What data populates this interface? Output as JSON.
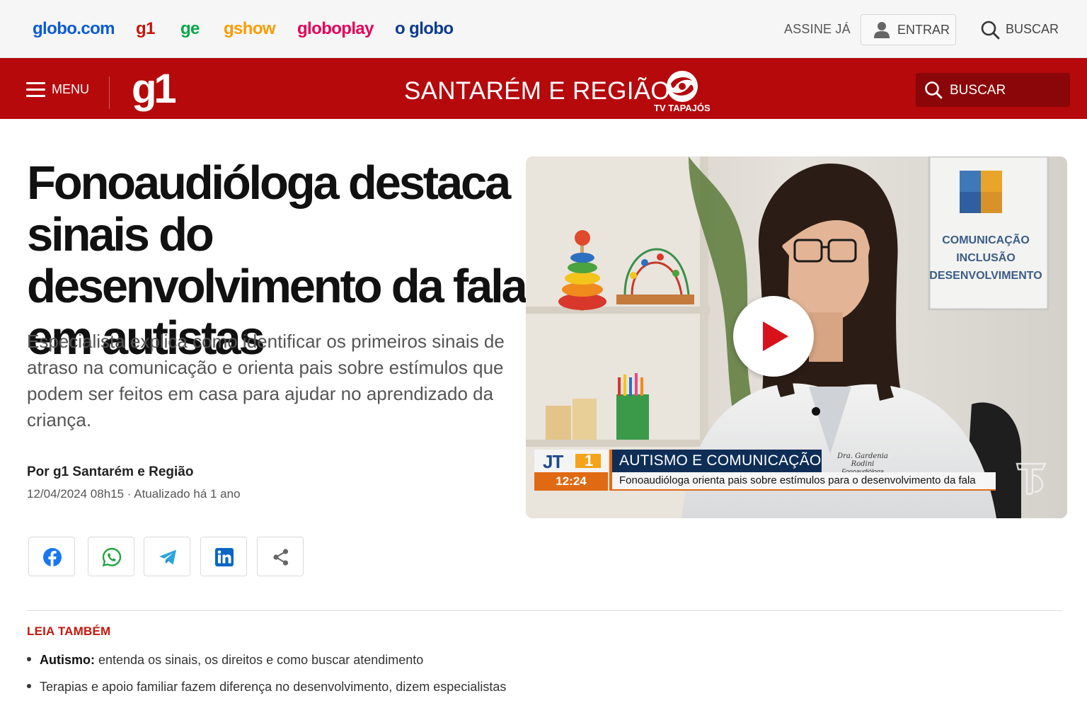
{
  "topbar": {
    "brands": {
      "globocom": "globo.com",
      "g1": "g1",
      "ge": "ge",
      "gshow": "gshow",
      "globoplay": "globoplay",
      "oglobo": "o globo"
    },
    "assine": "ASSINE JÁ",
    "entrar": "ENTRAR",
    "buscar": "BUSCAR"
  },
  "header": {
    "menu": "MENU",
    "logo": "g1",
    "region": "SANTARÉM E REGIÃO",
    "tv_label": "TV TAPAJÓS",
    "search": "BUSCAR"
  },
  "article": {
    "headline": "Fonoaudióloga destaca sinais do desenvolvimento da fala em autistas",
    "subtitle": "Especialista explica como identificar os primeiros sinais de atraso na comunicação e orienta pais sobre estímulos que podem ser feitos em casa para ajudar no aprendizado da criança.",
    "byline": "Por g1 Santarém e Região",
    "date": "12/04/2024 08h15 · Atualizado há 1 ano"
  },
  "share": [
    {
      "name": "facebook-icon"
    },
    {
      "name": "whatsapp-icon"
    },
    {
      "name": "telegram-icon"
    },
    {
      "name": "linkedin-icon"
    },
    {
      "name": "share-icon"
    }
  ],
  "video": {
    "poster_text": [
      "COMUNICAÇÃO",
      "INCLUSÃO",
      "DESENVOLVIMENTO"
    ],
    "program": "JT",
    "program_number": "1",
    "time": "12:24",
    "title": "AUTISMO E COMUNICAÇÃO",
    "caption": "Fonoaudióloga orienta pais sobre estímulos para o desenvolvimento da fala",
    "signature_name": "Dra. Gardenia Rodini",
    "signature_role": "Fonoaudióloga"
  },
  "related": {
    "heading": "LEIA TAMBÉM",
    "items": [
      {
        "bold": "Autismo:",
        "text": " entenda os sinais, os direitos e como buscar atendimento"
      },
      {
        "bold": "",
        "text": "Terapias e apoio familiar fazem diferença no desenvolvimento, dizem especialistas"
      }
    ]
  },
  "colors": {
    "g1_red": "#b5090c",
    "link_red": "#c4170c",
    "globoplay_pink": "#e6005a",
    "ge_green": "#06aa48",
    "gshow_orange": "#fa9c00",
    "globocom_blue": "#0b5bd3"
  }
}
